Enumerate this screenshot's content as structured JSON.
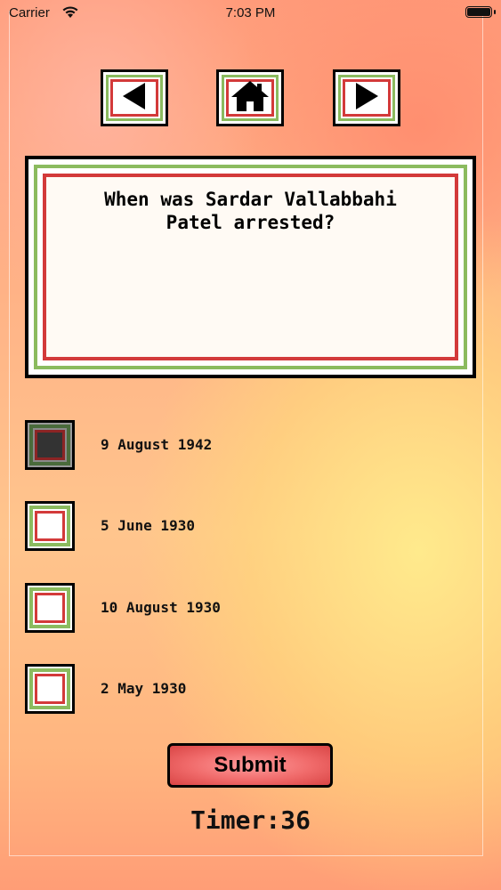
{
  "status_bar": {
    "carrier": "Carrier",
    "time": "7:03 PM"
  },
  "nav": {
    "back_icon": "triangle-left-icon",
    "home_icon": "house-icon",
    "next_icon": "triangle-right-icon"
  },
  "question": {
    "text": "When was Sardar Vallabbahi Patel arrested?"
  },
  "options": [
    {
      "label": "9 August 1942",
      "selected": true
    },
    {
      "label": "5 June 1930",
      "selected": false
    },
    {
      "label": "10 August 1930",
      "selected": false
    },
    {
      "label": "2 May 1930",
      "selected": false
    }
  ],
  "submit_label": "Submit",
  "timer_text": "Timer:36",
  "colors": {
    "border_green": "#8bbb5f",
    "border_red": "#d33a3a",
    "submit_red": "#f06a6a"
  }
}
